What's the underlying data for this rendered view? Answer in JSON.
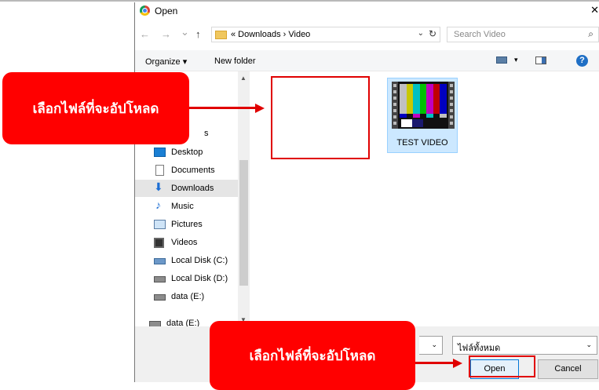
{
  "dialog": {
    "title": "Open",
    "close_glyph": "✕"
  },
  "address": {
    "back_glyph": "←",
    "forward_glyph": "→",
    "history_glyph": "⌄",
    "up_glyph": "↑",
    "path": "« Downloads › Video",
    "dropdown_glyph": "⌄",
    "refresh_glyph": "↻"
  },
  "search": {
    "placeholder": "Search Video",
    "icon_glyph": "⌕"
  },
  "toolbar": {
    "organize_label": "Organize ▾",
    "new_folder_label": "New folder",
    "view_dropdown_glyph": "▾",
    "help_glyph": "?"
  },
  "sidebar": {
    "items": [
      {
        "label": "s",
        "icon": "quick-access-icon"
      },
      {
        "label": "Desktop",
        "icon": "desktop-icon"
      },
      {
        "label": "Documents",
        "icon": "documents-icon"
      },
      {
        "label": "Downloads",
        "icon": "downloads-icon",
        "selected": true
      },
      {
        "label": "Music",
        "icon": "music-icon"
      },
      {
        "label": "Pictures",
        "icon": "pictures-icon"
      },
      {
        "label": "Videos",
        "icon": "videos-icon"
      },
      {
        "label": "Local Disk (C:)",
        "icon": "local-disk-c-icon"
      },
      {
        "label": "Local Disk (D:)",
        "icon": "local-disk-d-icon"
      },
      {
        "label": "data (E:)",
        "icon": "drive-e-icon"
      },
      {
        "label": "data (E:)",
        "icon": "drive-e-icon"
      }
    ],
    "scroll_up_glyph": "▲",
    "scroll_down_glyph": "▼"
  },
  "files": [
    {
      "name": "TEST VIDEO",
      "icon": "video-file-icon"
    }
  ],
  "colorbars": [
    "#c0c0c0",
    "#c8c800",
    "#00c0c0",
    "#00c000",
    "#c000c0",
    "#c00000",
    "#0000c0"
  ],
  "colorbars_low": [
    "#0000c0",
    "#111111",
    "#c000c0",
    "#111111",
    "#00c0c0",
    "#111111",
    "#c0c0c0"
  ],
  "footer": {
    "file_type_value": "ไฟล์ทั้งหมด",
    "file_type_dropdown_glyph": "⌄",
    "filename_dropdown_glyph": "⌄",
    "open_label": "Open",
    "cancel_label": "Cancel"
  },
  "annotations": {
    "callout_top": "เลือกไฟล์ที่จะอัปโหลด",
    "callout_bottom": "เลือกไฟล์ที่จะอัปโหลด",
    "accent_color": "#ff0000"
  }
}
